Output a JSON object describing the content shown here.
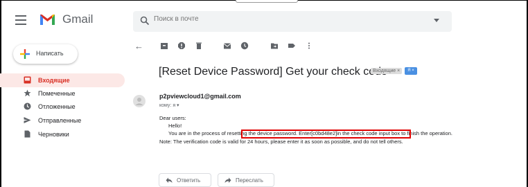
{
  "app": {
    "logo_text": "Gmail"
  },
  "search": {
    "placeholder": "Поиск в почте"
  },
  "compose": {
    "label": "Написать"
  },
  "sidebar": {
    "items": [
      {
        "label": "Входящие",
        "icon": "inbox-icon",
        "active": true
      },
      {
        "label": "Помеченные",
        "icon": "star-icon",
        "active": false
      },
      {
        "label": "Отложенные",
        "icon": "clock-icon",
        "active": false
      },
      {
        "label": "Отправленные",
        "icon": "send-icon",
        "active": false
      },
      {
        "label": "Черновики",
        "icon": "draft-icon",
        "active": false
      }
    ]
  },
  "message": {
    "subject": "[Reset Device Password] Get your check code",
    "labels": {
      "inbox": "Входящие ×",
      "extra": "Я ×"
    },
    "sender": "p2pviewcloud1@gmail.com",
    "to": "кому: я ▾",
    "body": {
      "greeting": "Dear users:",
      "hello": "Hello!",
      "line1": "You are in the process of resetting the device password. Enter[c0bd48e2]in the check code input box to finish the operation.",
      "line2": "Note: The verification code is valid for 24 hours, please enter it as soon as possible, and do not tell others."
    }
  },
  "actions": {
    "reply": "Ответить",
    "forward": "Переслать"
  },
  "colors": {
    "accent": "#d93025",
    "highlight": "#e00000",
    "label_blue": "#4a90e2"
  }
}
